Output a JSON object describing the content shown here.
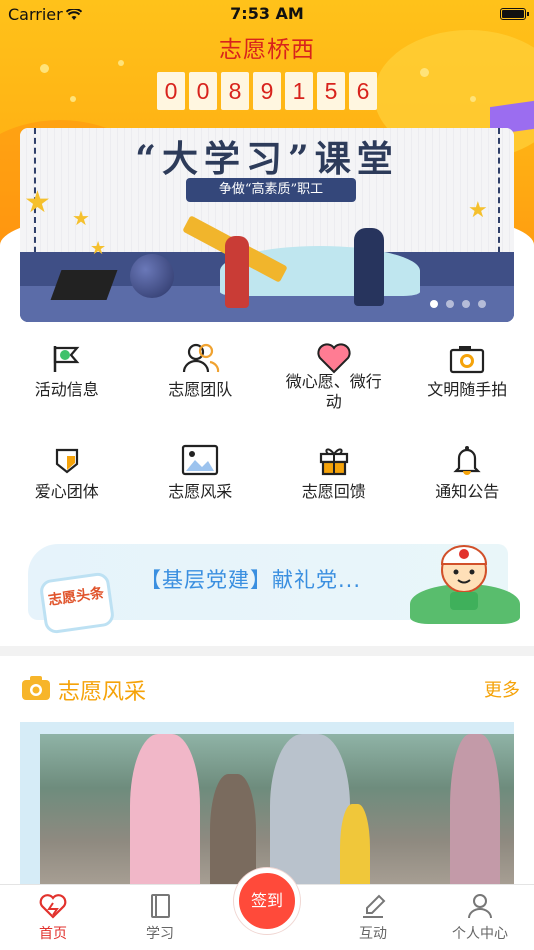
{
  "status_bar": {
    "carrier": "Carrier",
    "time": "7:53 AM"
  },
  "header": {
    "title": "志愿桥西",
    "counter_digits": [
      "0",
      "0",
      "8",
      "9",
      "1",
      "5",
      "6"
    ]
  },
  "banner": {
    "title": "“大学习”课堂",
    "subtitle": "争做“高素质”职工",
    "page_count": 4,
    "active_index": 0
  },
  "feature_grid": [
    {
      "label": "活动信息",
      "icon": "flag-icon"
    },
    {
      "label": "志愿团队",
      "icon": "team-icon"
    },
    {
      "label": "微心愿、微行动",
      "icon": "heart-icon"
    },
    {
      "label": "文明随手拍",
      "icon": "camera-icon"
    },
    {
      "label": "爱心团体",
      "icon": "shield-icon"
    },
    {
      "label": "志愿风采",
      "icon": "image-icon"
    },
    {
      "label": "志愿回馈",
      "icon": "gift-icon"
    },
    {
      "label": "通知公告",
      "icon": "bell-icon"
    }
  ],
  "notice": {
    "badge_text": "志愿头条",
    "headline": "【基层党建】献礼党..."
  },
  "section": {
    "title": "志愿风采",
    "more_label": "更多"
  },
  "tabbar": {
    "items": [
      {
        "label": "首页",
        "icon": "home-heart-icon",
        "active": true
      },
      {
        "label": "学习",
        "icon": "book-icon",
        "active": false
      },
      {
        "label": "互动",
        "icon": "edit-icon",
        "active": false
      },
      {
        "label": "个人中心",
        "icon": "person-icon",
        "active": false
      }
    ],
    "center_button": "签到"
  },
  "colors": {
    "accent": "#f5a30a",
    "primary_red": "#e2322d",
    "title_red": "#d8231c"
  }
}
